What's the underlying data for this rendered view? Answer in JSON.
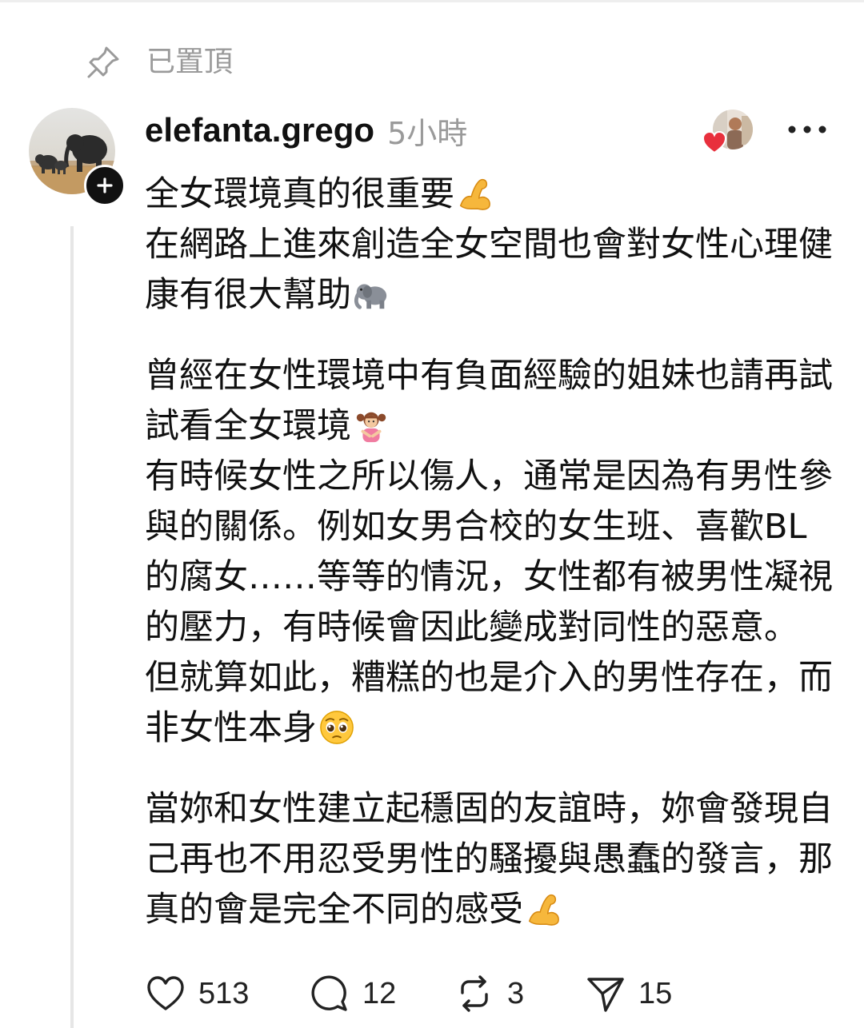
{
  "pinned": {
    "label": "已置頂",
    "icon": "pin-icon"
  },
  "author": {
    "username": "elefanta.grego",
    "time": "5小時",
    "avatar_icon": "elephant-avatar",
    "follow_icon": "plus-icon"
  },
  "header_right": {
    "liked_by_icon": "liked-by-avatar",
    "heart_icon": "red-heart-icon",
    "more_icon": "more-options-icon"
  },
  "post": {
    "paragraphs": [
      {
        "lines": [
          {
            "text": "全女環境真的很重要",
            "emoji": "flexed-biceps"
          },
          {
            "text": "在網路上進來創造全女空間也會對女性心理健"
          },
          {
            "text": "康有很大幫助",
            "emoji": "elephant"
          }
        ]
      },
      {
        "lines": [
          {
            "text": "曾經在女性環境中有負面經驗的姐妹也請再試"
          },
          {
            "text": "試看全女環境",
            "emoji": "woman-gesturing"
          },
          {
            "text": "有時候女性之所以傷人，通常是因為有男性參"
          },
          {
            "text": "與的關係。例如女男合校的女生班、喜歡BL"
          },
          {
            "text": "的腐女……等等的情況，女性都有被男性凝視"
          },
          {
            "text": "的壓力，有時候會因此變成對同性的惡意。"
          },
          {
            "text": "但就算如此，糟糕的也是介入的男性存在，而"
          },
          {
            "text": "非女性本身",
            "emoji": "pleading-face"
          }
        ]
      },
      {
        "lines": [
          {
            "text": "當妳和女性建立起穩固的友誼時，妳會發現自"
          },
          {
            "text": "己再也不用忍受男性的騷擾與愚蠢的發言，那"
          },
          {
            "text": "真的會是完全不同的感受",
            "emoji": "flexed-biceps"
          }
        ]
      }
    ]
  },
  "actions": {
    "likes": "513",
    "comments": "12",
    "reposts": "3",
    "shares": "15"
  },
  "colors": {
    "text": "#111111",
    "muted": "#9a9a9a",
    "thread_line": "#e6e6e6",
    "heart": "#e8303d"
  }
}
